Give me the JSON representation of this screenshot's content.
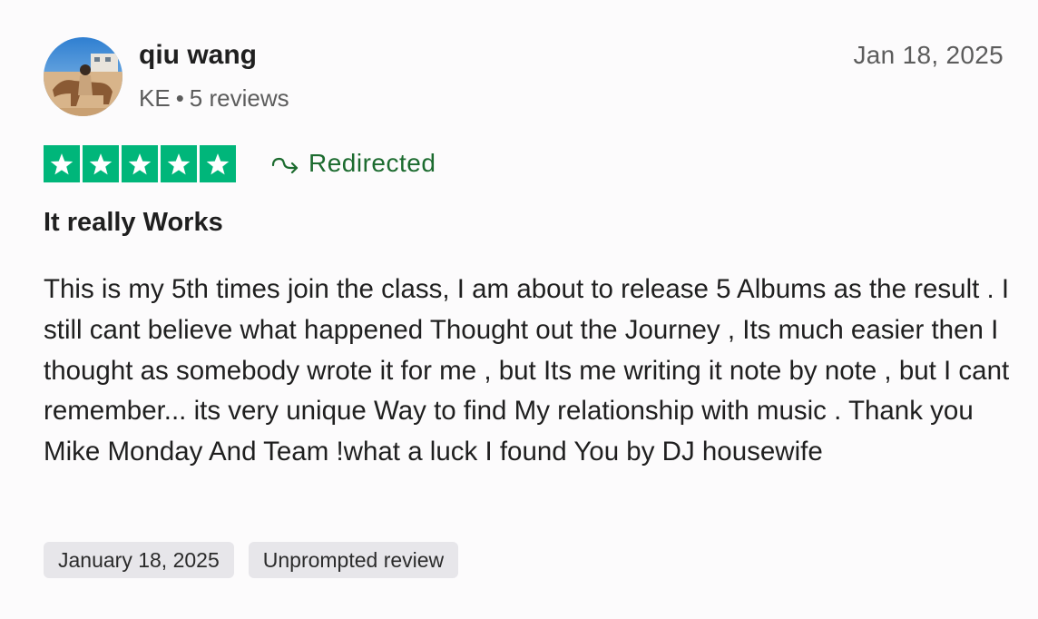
{
  "reviewer": {
    "name": "qiu wang",
    "country": "KE",
    "separator": "•",
    "review_count": "5 reviews",
    "avatar_icon": "user-photo-avatar"
  },
  "review": {
    "date": "Jan 18, 2025",
    "rating": 5,
    "max_rating": 5,
    "star_color": "#00b67a",
    "redirected_label": "Redirected",
    "redirected_color": "#1c6b2f",
    "title": "It really Works",
    "body": "This is my 5th times join the class, I am about to release 5 Albums as the result . I still cant believe what happened Thought out the Journey , Its much easier then I thought as somebody wrote it for me , but Its me writing it note by note , but I cant remember... its very unique Way to find My relationship with music . Thank you Mike Monday And Team !what a luck I found You by DJ housewife"
  },
  "tags": {
    "experience_date": "January 18, 2025",
    "review_type": "Unprompted review"
  }
}
